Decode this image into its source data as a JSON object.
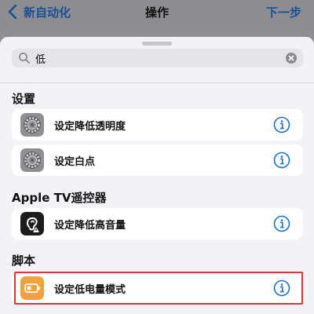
{
  "nav": {
    "back_label": "新自动化",
    "title": "操作",
    "next_label": "下一步"
  },
  "search": {
    "value": "低"
  },
  "sections": [
    {
      "header": "设置",
      "items": [
        {
          "label": "设定降低透明度",
          "icon": "settings-gear-icon"
        },
        {
          "label": "设定白点",
          "icon": "settings-gear-icon"
        }
      ]
    },
    {
      "header": "Apple TV遥控器",
      "items": [
        {
          "label": "设定降低高音量",
          "icon": "hearing-ear-icon"
        }
      ]
    },
    {
      "header": "脚本",
      "items": [
        {
          "label": "设定低电量模式",
          "icon": "battery-icon"
        }
      ]
    }
  ],
  "colors": {
    "accent": "#1b4f93",
    "info_blue": "#1a6fd6",
    "highlight_red": "#e23434",
    "script_orange": "#f5a13b"
  }
}
